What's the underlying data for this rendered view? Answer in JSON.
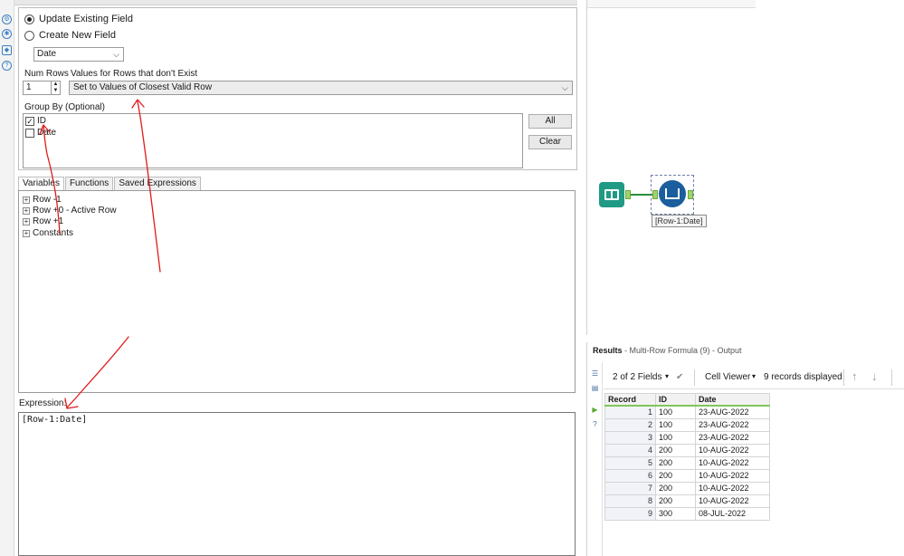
{
  "rail_icons": [
    "gear-icon",
    "tool-icon",
    "tag-icon",
    "help-icon"
  ],
  "config": {
    "update_existing_label": "Update Existing Field",
    "create_new_label": "Create New  Field",
    "field_selected": "Date",
    "num_rows_label": "Num Rows",
    "num_rows_value": "1",
    "values_label": "Values for Rows that don't Exist",
    "values_selected": "Set to Values of Closest Valid Row",
    "group_by_label": "Group By (Optional)",
    "group_items": [
      {
        "label": "ID",
        "checked": true
      },
      {
        "label": "Date",
        "checked": false
      }
    ],
    "all_button": "All",
    "clear_button": "Clear",
    "tabs": [
      "Variables",
      "Functions",
      "Saved Expressions"
    ],
    "tree_items": [
      "Row -1",
      "Row +0 - Active Row",
      "Row +1",
      "Constants"
    ],
    "expression_label": "Expression:",
    "expression_value": "[Row-1:Date]"
  },
  "canvas": {
    "annotation": "[Row-1:Date]"
  },
  "results": {
    "title": "Results",
    "subtitle": "- Multi-Row Formula (9) - Output",
    "fields_label": "2 of 2 Fields",
    "cell_viewer_label": "Cell Viewer",
    "records_label": "9 records displayed",
    "columns": [
      "Record",
      "ID",
      "Date"
    ],
    "rows": [
      [
        "1",
        "100",
        "23-AUG-2022"
      ],
      [
        "2",
        "100",
        "23-AUG-2022"
      ],
      [
        "3",
        "100",
        "23-AUG-2022"
      ],
      [
        "4",
        "200",
        "10-AUG-2022"
      ],
      [
        "5",
        "200",
        "10-AUG-2022"
      ],
      [
        "6",
        "200",
        "10-AUG-2022"
      ],
      [
        "7",
        "200",
        "10-AUG-2022"
      ],
      [
        "8",
        "200",
        "10-AUG-2022"
      ],
      [
        "9",
        "300",
        "08-JUL-2022"
      ]
    ]
  }
}
